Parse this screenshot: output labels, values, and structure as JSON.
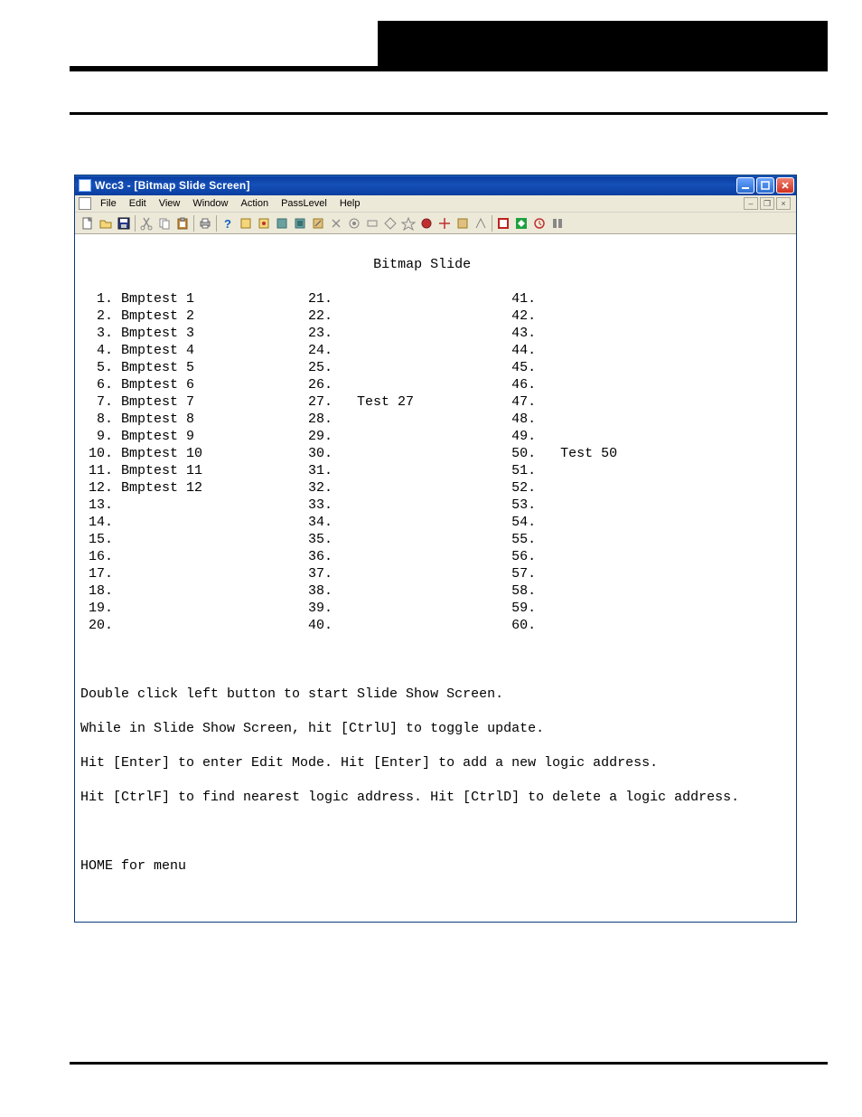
{
  "window": {
    "title": "Wcc3 - [Bitmap Slide Screen]"
  },
  "menu": {
    "items": [
      "File",
      "Edit",
      "View",
      "Window",
      "Action",
      "PassLevel",
      "Help"
    ]
  },
  "toolbar": {
    "icons": [
      "new-icon",
      "open-icon",
      "save-icon",
      "sep",
      "cut-icon",
      "copy-icon",
      "paste-icon",
      "sep",
      "print-icon",
      "sep",
      "help-icon",
      "tool-a-icon",
      "tool-b-icon",
      "tool-c-icon",
      "tool-d-icon",
      "tool-e-icon",
      "tool-f-icon",
      "tool-g-icon",
      "tool-h-icon",
      "tool-i-icon",
      "tool-j-icon",
      "tool-k-icon",
      "tool-l-icon",
      "tool-m-icon",
      "tool-n-icon",
      "sep",
      "tool-o-icon",
      "tool-p-icon",
      "tool-q-icon",
      "tool-r-icon"
    ]
  },
  "client": {
    "title": "Bitmap Slide",
    "columns": {
      "col1": [
        {
          "n": "1",
          "label": "Bmptest 1"
        },
        {
          "n": "2",
          "label": "Bmptest 2"
        },
        {
          "n": "3",
          "label": "Bmptest 3"
        },
        {
          "n": "4",
          "label": "Bmptest 4"
        },
        {
          "n": "5",
          "label": "Bmptest 5"
        },
        {
          "n": "6",
          "label": "Bmptest 6"
        },
        {
          "n": "7",
          "label": "Bmptest 7"
        },
        {
          "n": "8",
          "label": "Bmptest 8"
        },
        {
          "n": "9",
          "label": "Bmptest 9"
        },
        {
          "n": "10",
          "label": "Bmptest 10"
        },
        {
          "n": "11",
          "label": "Bmptest 11"
        },
        {
          "n": "12",
          "label": "Bmptest 12"
        },
        {
          "n": "13",
          "label": ""
        },
        {
          "n": "14",
          "label": ""
        },
        {
          "n": "15",
          "label": ""
        },
        {
          "n": "16",
          "label": ""
        },
        {
          "n": "17",
          "label": ""
        },
        {
          "n": "18",
          "label": ""
        },
        {
          "n": "19",
          "label": ""
        },
        {
          "n": "20",
          "label": ""
        }
      ],
      "col2": [
        {
          "n": "21",
          "label": ""
        },
        {
          "n": "22",
          "label": ""
        },
        {
          "n": "23",
          "label": ""
        },
        {
          "n": "24",
          "label": ""
        },
        {
          "n": "25",
          "label": ""
        },
        {
          "n": "26",
          "label": ""
        },
        {
          "n": "27",
          "label": "Test 27"
        },
        {
          "n": "28",
          "label": ""
        },
        {
          "n": "29",
          "label": ""
        },
        {
          "n": "30",
          "label": ""
        },
        {
          "n": "31",
          "label": ""
        },
        {
          "n": "32",
          "label": ""
        },
        {
          "n": "33",
          "label": ""
        },
        {
          "n": "34",
          "label": ""
        },
        {
          "n": "35",
          "label": ""
        },
        {
          "n": "36",
          "label": ""
        },
        {
          "n": "37",
          "label": ""
        },
        {
          "n": "38",
          "label": ""
        },
        {
          "n": "39",
          "label": ""
        },
        {
          "n": "40",
          "label": ""
        }
      ],
      "col3": [
        {
          "n": "41",
          "label": ""
        },
        {
          "n": "42",
          "label": ""
        },
        {
          "n": "43",
          "label": ""
        },
        {
          "n": "44",
          "label": ""
        },
        {
          "n": "45",
          "label": ""
        },
        {
          "n": "46",
          "label": ""
        },
        {
          "n": "47",
          "label": ""
        },
        {
          "n": "48",
          "label": ""
        },
        {
          "n": "49",
          "label": ""
        },
        {
          "n": "50",
          "label": "Test 50"
        },
        {
          "n": "51",
          "label": ""
        },
        {
          "n": "52",
          "label": ""
        },
        {
          "n": "53",
          "label": ""
        },
        {
          "n": "54",
          "label": ""
        },
        {
          "n": "55",
          "label": ""
        },
        {
          "n": "56",
          "label": ""
        },
        {
          "n": "57",
          "label": ""
        },
        {
          "n": "58",
          "label": ""
        },
        {
          "n": "59",
          "label": ""
        },
        {
          "n": "60",
          "label": ""
        }
      ]
    },
    "instructions": [
      "Double click left button to start Slide Show Screen.",
      "While in Slide Show Screen, hit [CtrlU] to toggle update.",
      "Hit [Enter] to enter Edit Mode. Hit [Enter] to add a new logic address.",
      "Hit [CtrlF] to find nearest logic address. Hit [CtrlD] to delete a logic address."
    ],
    "home": "HOME for menu"
  }
}
